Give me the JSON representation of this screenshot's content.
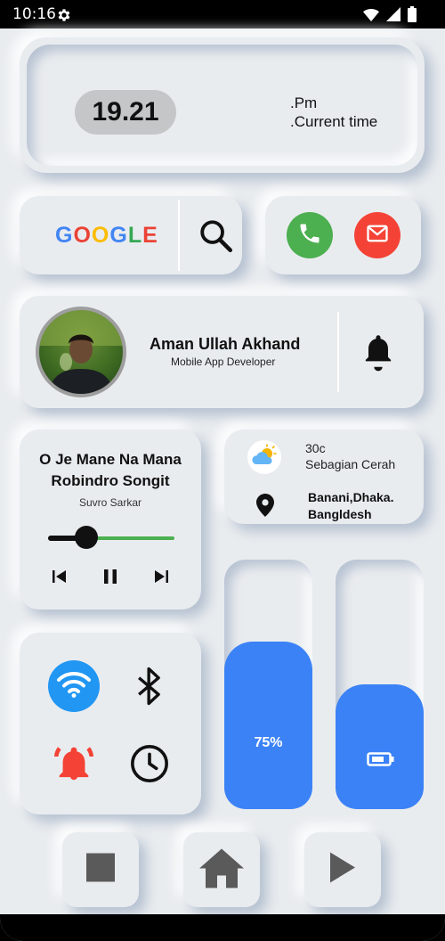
{
  "status_bar": {
    "time": "10:16",
    "icons": [
      "gear-icon",
      "wifi-icon",
      "signal-icon",
      "battery-icon"
    ]
  },
  "time_card": {
    "time": "19.21",
    "period": ".Pm",
    "label": ".Current time"
  },
  "search_card": {
    "brand": "GOOGLE",
    "brand_colors": [
      "#4285F4",
      "#EA4335",
      "#FBBC05",
      "#4285F4",
      "#34A853",
      "#EA4335"
    ],
    "icon": "search-icon"
  },
  "contact_card": {
    "call_icon": "phone-icon",
    "call_color": "#4caf50",
    "mail_icon": "mail-icon",
    "mail_color": "#f44336"
  },
  "profile": {
    "name": "Aman Ullah Akhand",
    "role": "Mobile App Developer",
    "notification_icon": "bell-icon"
  },
  "music": {
    "title": "O Je Mane Na Mana Robindro Songit",
    "artist": "Suvro Sarkar",
    "progress": 0.3,
    "controls": [
      "skip-previous-icon",
      "pause-icon",
      "skip-next-icon"
    ]
  },
  "weather": {
    "temperature": "30c",
    "condition": "Sebagian Cerah",
    "location_line1": "Banani,Dhaka.",
    "location_line2": "Bangldesh"
  },
  "quick_toggles": {
    "wifi": {
      "icon": "wifi-icon",
      "active": true,
      "color": "#2196f3"
    },
    "bluetooth": {
      "icon": "bluetooth-icon",
      "active": false
    },
    "alarm": {
      "icon": "alarm-icon",
      "color": "#f44336"
    },
    "clock": {
      "icon": "clock-icon"
    }
  },
  "sliders": {
    "volume": {
      "label": "75%",
      "level": 0.67,
      "color": "#3b82f6"
    },
    "battery": {
      "icon": "battery-icon",
      "level": 0.5,
      "color": "#3b82f6"
    }
  },
  "nav": {
    "recent_icon": "square-icon",
    "home_icon": "home-icon",
    "back_icon": "play-icon"
  }
}
